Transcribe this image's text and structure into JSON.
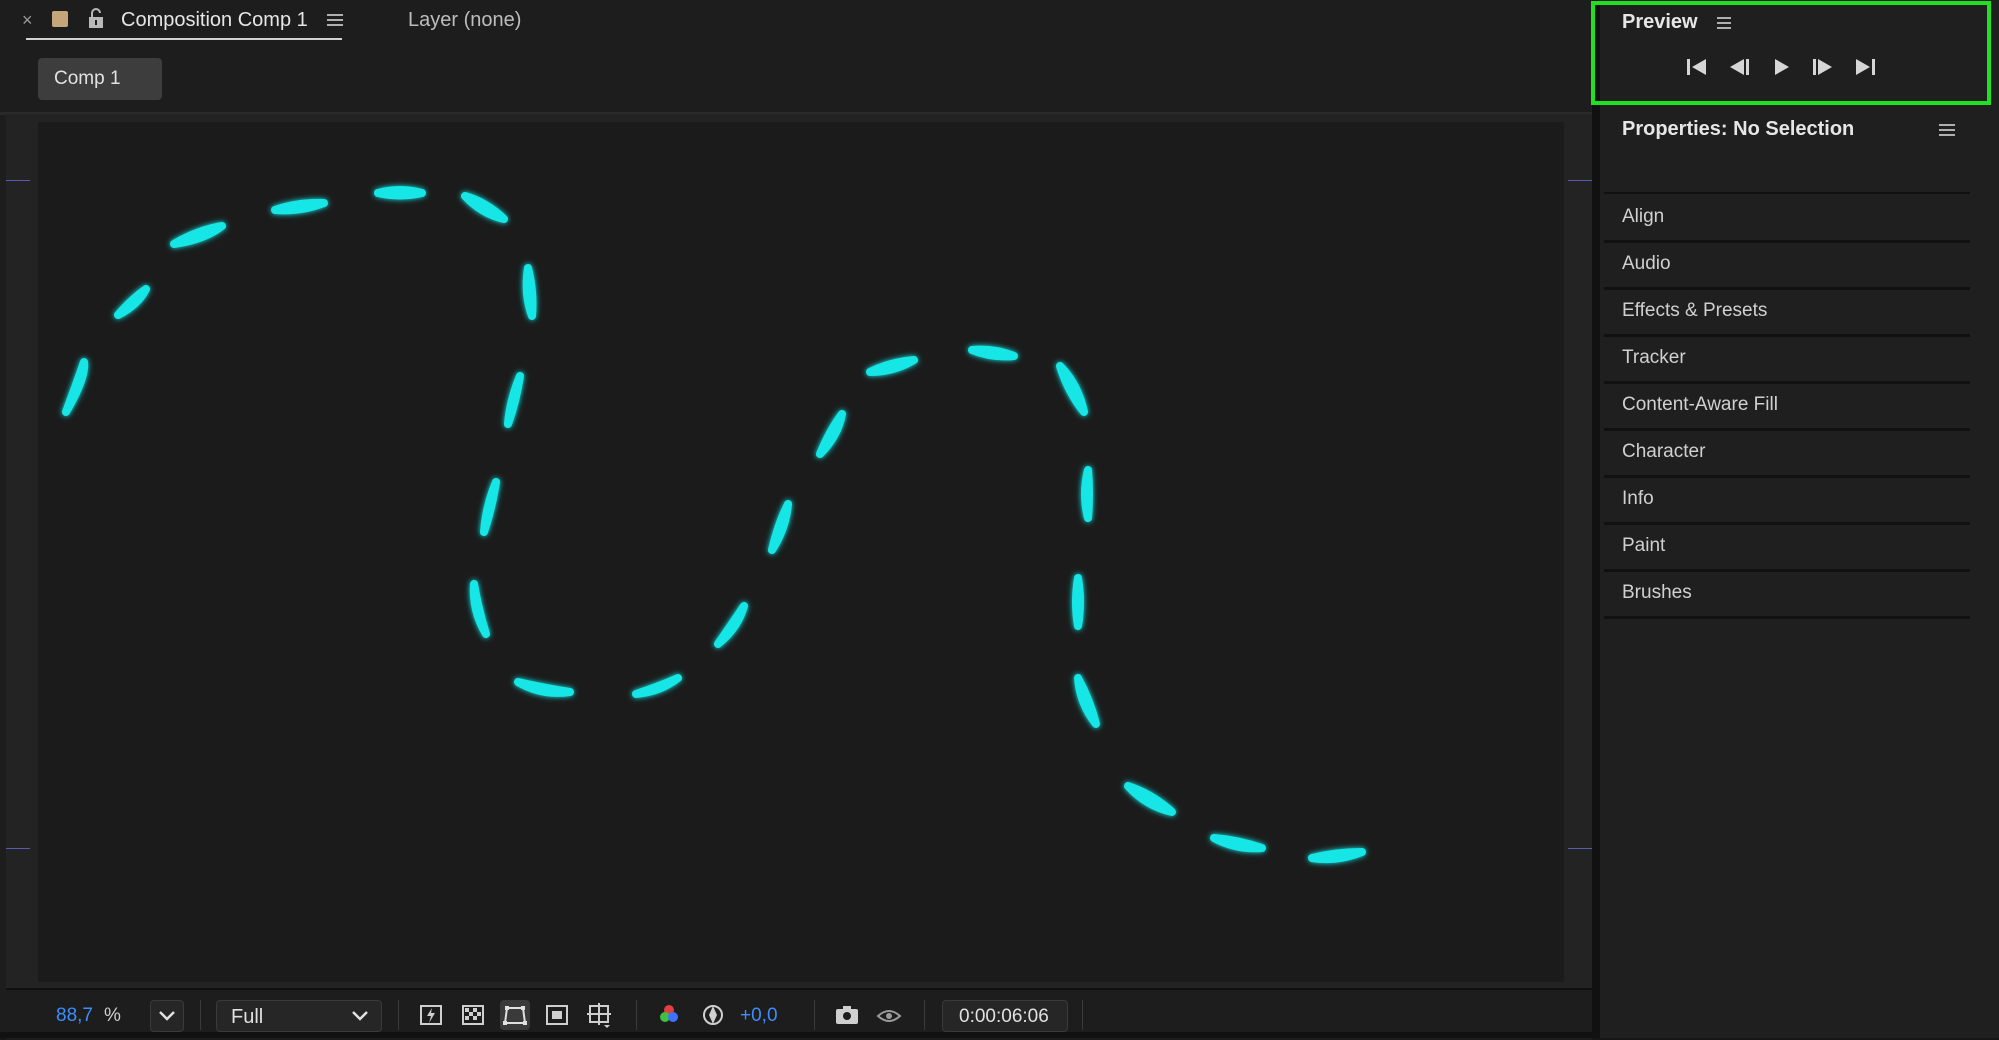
{
  "composition_tab": {
    "close_label": "×",
    "title": "Composition Comp 1",
    "layer_tab": "Layer (none)"
  },
  "breadcrumb": {
    "comp": "Comp 1"
  },
  "viewer": {
    "stroke_color": "#19e6e6",
    "background": "#1b1b1b"
  },
  "toolbar": {
    "zoom_value": "88,7",
    "zoom_unit": "%",
    "resolution": "Full",
    "exposure": "+0,0",
    "timecode": "0:00:06:06"
  },
  "preview": {
    "title": "Preview",
    "buttons": [
      "first-frame-icon",
      "previous-frame-icon",
      "play-icon",
      "next-frame-icon",
      "last-frame-icon"
    ],
    "highlight_color": "#21e021"
  },
  "properties": {
    "title": "Properties: No Selection"
  },
  "panels": [
    {
      "label": "Align"
    },
    {
      "label": "Audio"
    },
    {
      "label": "Effects & Presets"
    },
    {
      "label": "Tracker"
    },
    {
      "label": "Content-Aware Fill"
    },
    {
      "label": "Character"
    },
    {
      "label": "Info"
    },
    {
      "label": "Paint"
    },
    {
      "label": "Brushes"
    }
  ]
}
